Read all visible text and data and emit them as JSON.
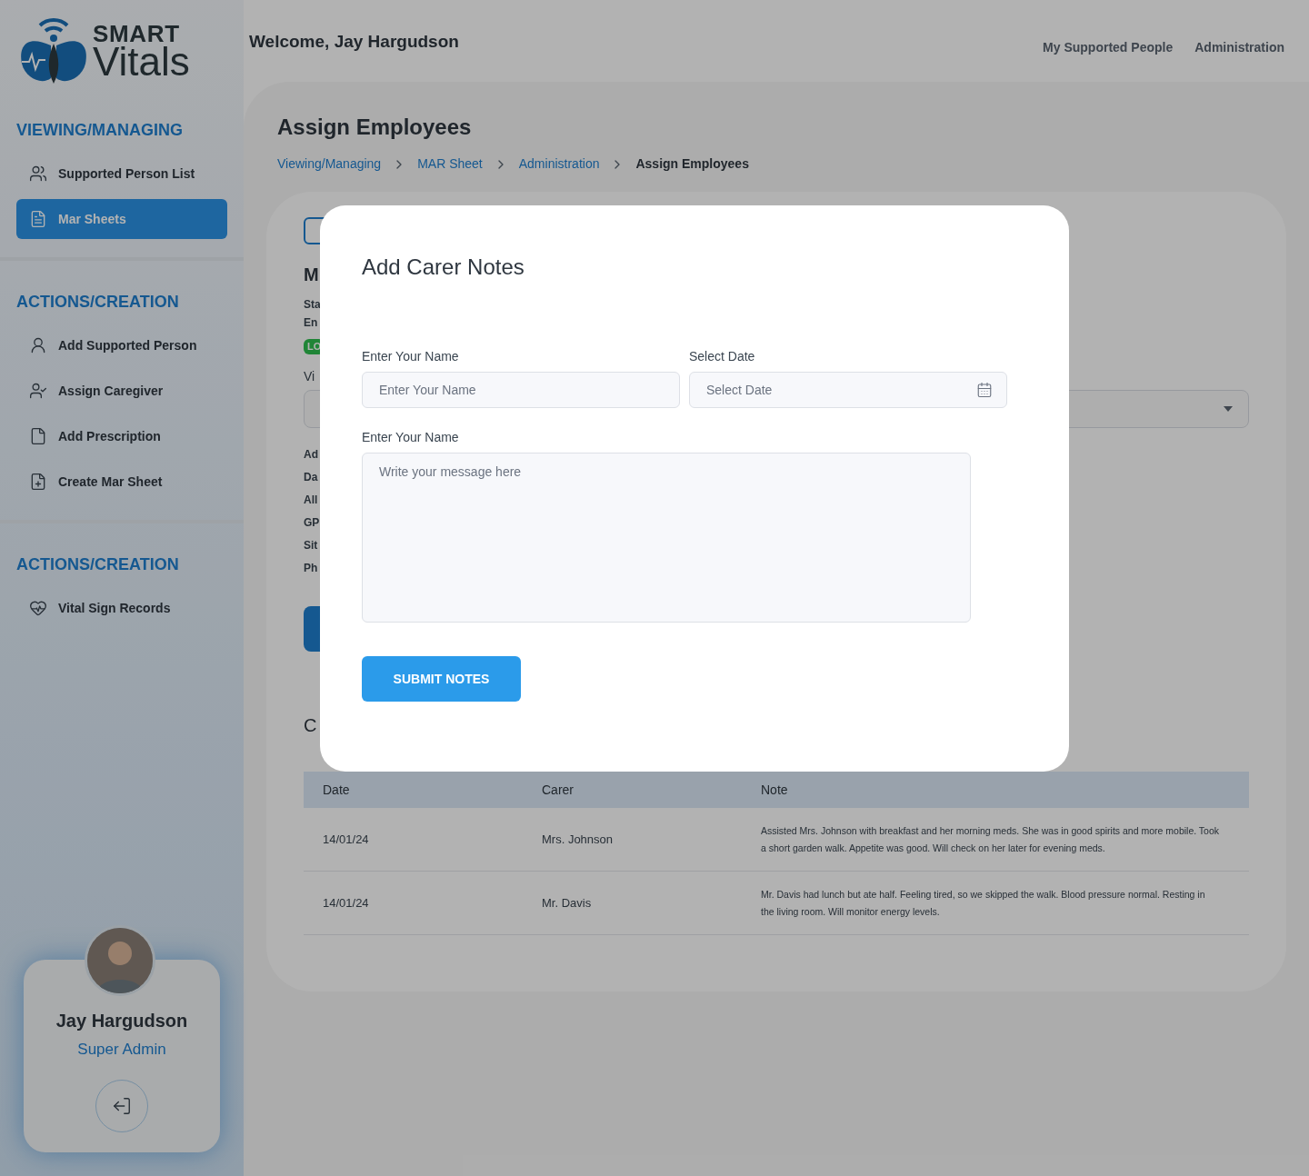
{
  "logo": {
    "line_1": "SMART",
    "line_2": "Vitals"
  },
  "sidebar": {
    "sections": [
      {
        "heading": "VIEWING/MANAGING",
        "items": [
          {
            "label": "Supported Person List",
            "selected": false
          },
          {
            "label": "Mar Sheets",
            "selected": true
          }
        ]
      },
      {
        "heading": "ACTIONS/CREATION",
        "items": [
          {
            "label": "Add Supported Person",
            "selected": false
          },
          {
            "label": "Assign Caregiver",
            "selected": false
          },
          {
            "label": "Add Prescription",
            "selected": false
          },
          {
            "label": "Create Mar Sheet",
            "selected": false
          }
        ]
      },
      {
        "heading": "ACTIONS/CREATION",
        "items": [
          {
            "label": "Vital Sign Records",
            "selected": false
          }
        ]
      }
    ]
  },
  "profile": {
    "name": "Jay Hargudson",
    "role": "Super Admin"
  },
  "header": {
    "welcome": "Welcome, Jay Hargudson",
    "nav": [
      "My Supported People",
      "Administration"
    ]
  },
  "page": {
    "title": "Assign Employees",
    "breadcrumb": [
      {
        "label": "Viewing/Managing",
        "current": false
      },
      {
        "label": "MAR Sheet",
        "current": false
      },
      {
        "label": "Administration",
        "current": false
      },
      {
        "label": "Assign Employees",
        "current": true
      }
    ]
  },
  "background": {
    "heading": "M",
    "lines_1": [
      "Sta",
      "En"
    ],
    "badge": "LO",
    "select_label": "Vi",
    "lines_2": [
      "Ad",
      "Da",
      "All",
      "GP",
      "Sit",
      "Ph"
    ],
    "notes_heading": "C"
  },
  "table": {
    "columns": [
      "Date",
      "Carer",
      "Note"
    ],
    "rows": [
      {
        "date": "14/01/24",
        "carer": "Mrs. Johnson",
        "note": "Assisted Mrs. Johnson with breakfast and her morning meds. She was in good spirits and more mobile. Took a short garden walk. Appetite was good. Will check on her later for evening meds."
      },
      {
        "date": "14/01/24",
        "carer": "Mr. Davis",
        "note": "Mr. Davis had lunch but ate half. Feeling tired, so we skipped the walk. Blood pressure normal. Resting in the living room. Will monitor energy levels."
      }
    ]
  },
  "modal": {
    "title": "Add Carer Notes",
    "name_label": "Enter Your Name",
    "name_placeholder": "Enter Your Name",
    "date_label": "Select Date",
    "date_placeholder": "Select Date",
    "message_label": "Enter Your Name",
    "message_placeholder": "Write your message here",
    "submit": "SUBMIT NOTES"
  }
}
